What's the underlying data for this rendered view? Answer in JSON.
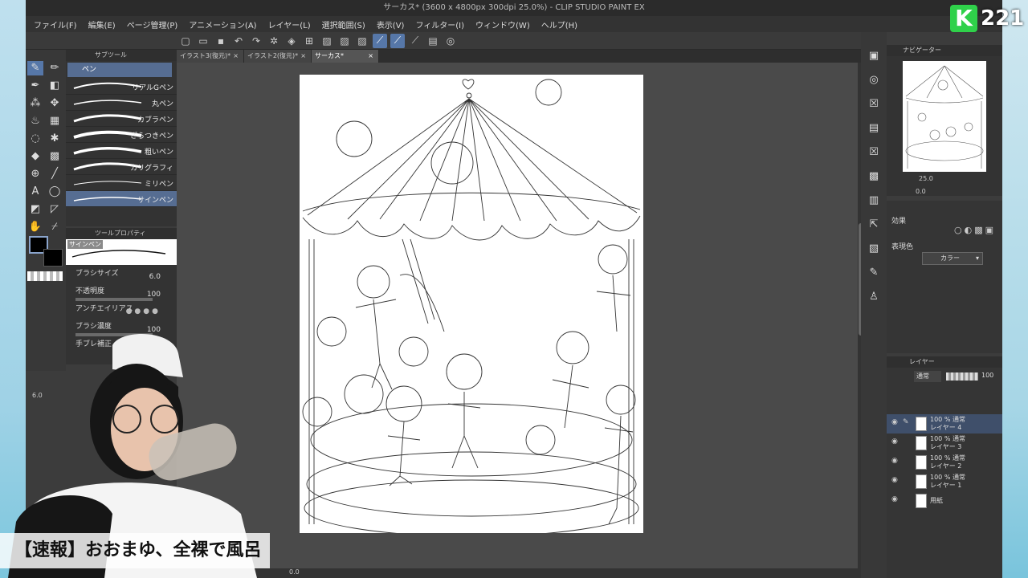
{
  "window": {
    "title": "サーカス* (3600 x 4800px 300dpi 25.0%) - CLIP STUDIO PAINT EX"
  },
  "menu": [
    "ファイル(F)",
    "編集(E)",
    "ページ管理(P)",
    "アニメーション(A)",
    "レイヤー(L)",
    "選択範囲(S)",
    "表示(V)",
    "フィルター(I)",
    "ウィンドウ(W)",
    "ヘルプ(H)"
  ],
  "tabs": [
    {
      "label": "イラスト3(復元)*",
      "close": "×"
    },
    {
      "label": "イラスト2(復元)*",
      "close": "×"
    },
    {
      "label": "サーカス*",
      "close": "×"
    }
  ],
  "subtool": {
    "header": "サブツール",
    "group": "ペン",
    "brushes": [
      "リアルGペン",
      "丸ペン",
      "カブラペン",
      "ざらつきペン",
      "粗いペン",
      "カリグラフィ",
      "ミリペン",
      "サインペン"
    ]
  },
  "tool_property": {
    "header": "ツールプロパティ",
    "current": "サインペン",
    "brush_size_label": "ブラシサイズ",
    "brush_size": "6.0",
    "opacity_label": "不透明度",
    "opacity": "100",
    "antialias_label": "アンチエイリアス",
    "density_label": "ブラシ濃度",
    "density": "100",
    "stabilize_label": "手ブレ補正",
    "size_readout": "6.0",
    "size_unit": "px",
    "small_value": "10"
  },
  "navigator": {
    "header": "ナビゲーター",
    "zoom": "25.0",
    "rotation": "0.0"
  },
  "effects": {
    "label": "効果",
    "expression_label": "表現色",
    "expression_value": "カラー"
  },
  "layers": {
    "header": "レイヤー",
    "blend": "通常",
    "opacity": "100",
    "items": [
      {
        "mode": "100 % 通常",
        "name": "レイヤー 4",
        "selected": true
      },
      {
        "mode": "100 % 通常",
        "name": "レイヤー 3",
        "selected": false
      },
      {
        "mode": "100 % 通常",
        "name": "レイヤー 2",
        "selected": false
      },
      {
        "mode": "100 % 通常",
        "name": "レイヤー 1",
        "selected": false
      },
      {
        "mode": "",
        "name": "用紙",
        "selected": false
      }
    ]
  },
  "status": {
    "zoom": "0.0"
  },
  "overlay": {
    "channel_letter": "K",
    "channel_number": "221",
    "caption": "【速報】おおまゆ、全裸で風呂"
  },
  "colors": {
    "accent": "#5677a8",
    "logo_green": "#2fd14a",
    "panel": "#333333"
  }
}
